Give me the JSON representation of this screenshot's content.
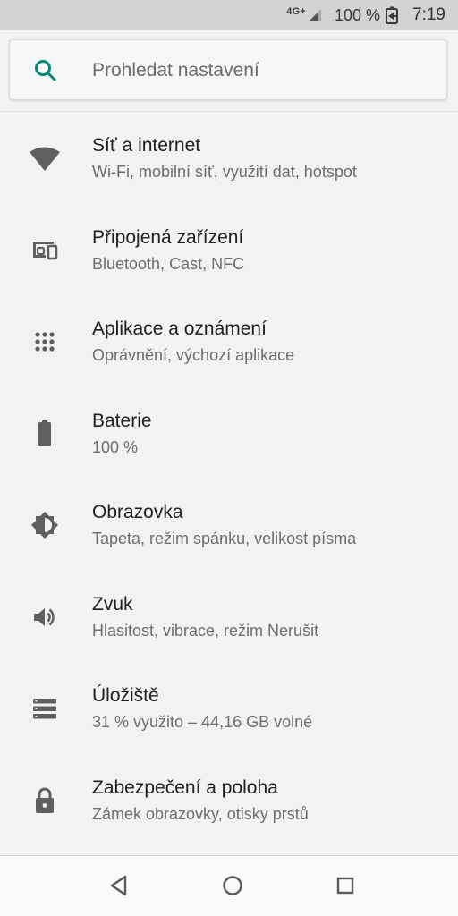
{
  "status_bar": {
    "network_type": "4G+",
    "battery_percent": "100 %",
    "time": "7:19"
  },
  "search": {
    "placeholder": "Prohledat nastavení",
    "icon": "search-icon",
    "accent_color": "#00897b"
  },
  "settings": {
    "items": [
      {
        "icon": "wifi-icon",
        "title": "Síť a internet",
        "subtitle": "Wi-Fi, mobilní síť, využití dat, hotspot"
      },
      {
        "icon": "connected-devices-icon",
        "title": "Připojená zařízení",
        "subtitle": "Bluetooth, Cast, NFC"
      },
      {
        "icon": "apps-grid-icon",
        "title": "Aplikace a oznámení",
        "subtitle": "Oprávnění, výchozí aplikace"
      },
      {
        "icon": "battery-icon",
        "title": "Baterie",
        "subtitle": "100 %"
      },
      {
        "icon": "brightness-icon",
        "title": "Obrazovka",
        "subtitle": "Tapeta, režim spánku, velikost písma"
      },
      {
        "icon": "volume-icon",
        "title": "Zvuk",
        "subtitle": "Hlasitost, vibrace, režim Nerušit"
      },
      {
        "icon": "storage-icon",
        "title": "Úložiště",
        "subtitle": "31 % využito – 44,16 GB volné"
      },
      {
        "icon": "lock-icon",
        "title": "Zabezpečení a poloha",
        "subtitle": "Zámek obrazovky, otisky prstů"
      }
    ]
  },
  "nav_bar": {
    "buttons": [
      "back-icon",
      "home-icon",
      "recents-icon"
    ]
  }
}
